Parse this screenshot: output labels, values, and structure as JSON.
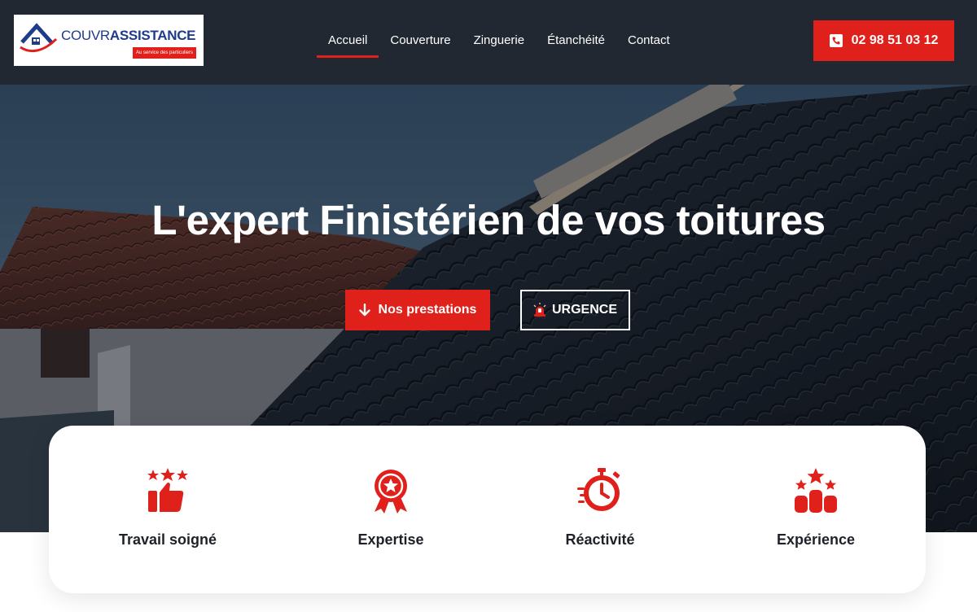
{
  "brand": {
    "logo_light": "COUVR",
    "logo_bold": "ASSISTANCE",
    "logo_tagline": "Au service des particuliers"
  },
  "nav": {
    "items": [
      {
        "label": "Accueil",
        "active": true
      },
      {
        "label": "Couverture",
        "active": false
      },
      {
        "label": "Zinguerie",
        "active": false
      },
      {
        "label": "Étanchéité",
        "active": false
      },
      {
        "label": "Contact",
        "active": false
      }
    ]
  },
  "header": {
    "phone_label": "02 98 51 03 12",
    "phone_icon": "phone-icon"
  },
  "hero": {
    "title": "L'expert Finistérien de vos toitures",
    "primary_button": "Nos prestations",
    "primary_icon": "arrow-down-icon",
    "secondary_button": "URGENCE",
    "secondary_icon": "siren-icon"
  },
  "features": [
    {
      "label": "Travail soigné",
      "icon": "thumbs-up-stars-icon"
    },
    {
      "label": "Expertise",
      "icon": "award-badge-icon"
    },
    {
      "label": "Réactivité",
      "icon": "stopwatch-speed-icon"
    },
    {
      "label": "Expérience",
      "icon": "ranking-podium-icon"
    }
  ],
  "colors": {
    "accent": "#e0201b",
    "header_bg": "#222831",
    "brand_blue": "#1f3b8c",
    "text_dark": "#1e2228"
  }
}
